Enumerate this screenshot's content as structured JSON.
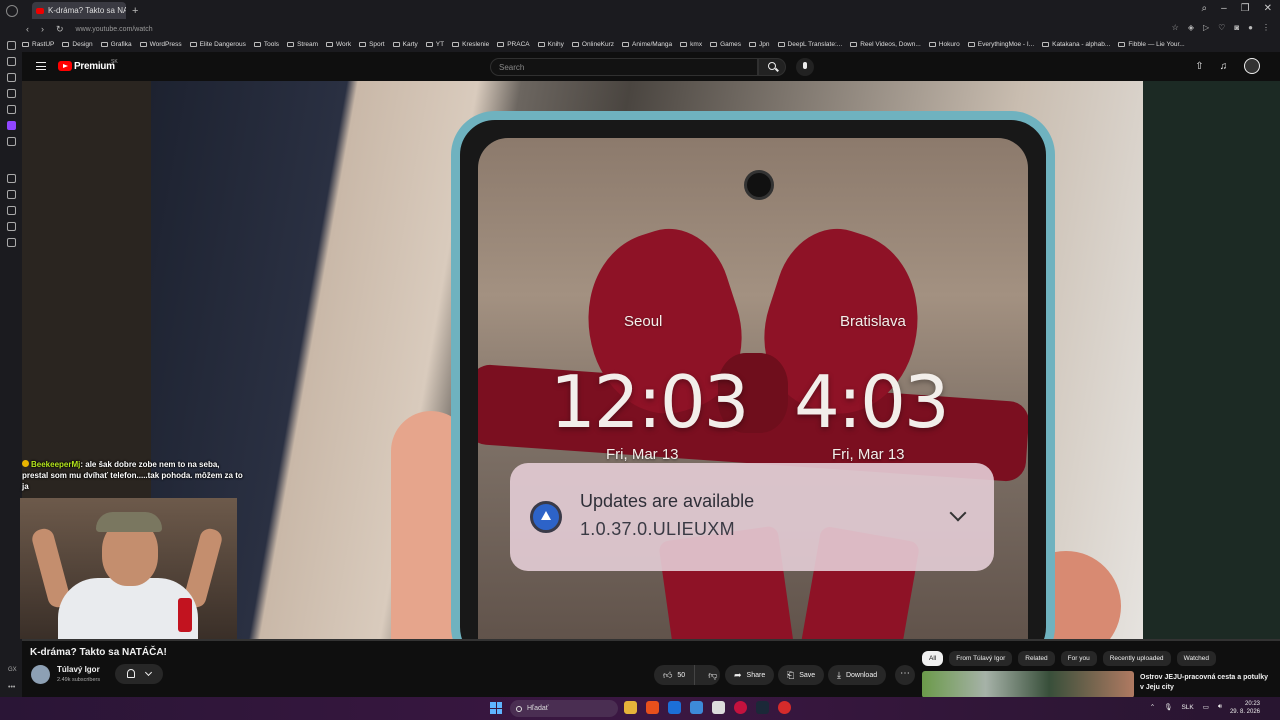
{
  "browser": {
    "tab_title": "K-dráma? Takto sa NA...",
    "url": "www.youtube.com/watch",
    "bookmarks": [
      "RastUP",
      "Design",
      "Grafika",
      "WordPress",
      "Elite Dangerous",
      "Tools",
      "Stream",
      "Work",
      "Sport",
      "Karty",
      "YT",
      "Kreslenie",
      "PRACA",
      "Knihy",
      "OnlineKurz",
      "Anime/Manga",
      "kmx",
      "Games",
      "Jpn",
      "DeepL Translate:...",
      "Reel Videos, Down...",
      "Hokuro",
      "EverythingMoe - I...",
      "Katakana - alphab...",
      "Fibble — Lie Your..."
    ]
  },
  "youtube": {
    "brand": "Premium",
    "country": "SK",
    "search_placeholder": "Search"
  },
  "video": {
    "screen": {
      "city_left": "Seoul",
      "city_right": "Bratislava",
      "time_left": "12:03",
      "time_right": "4:03",
      "date_left": "Fri, Mar 13",
      "date_right": "Fri, Mar 13",
      "notif_title": "Updates are available",
      "notif_version": "1.0.37.0.ULIEUXM"
    },
    "title": "K-dráma? Takto sa NATÁČA!",
    "channel": "Túlavý Igor",
    "subscribers": "2.49k subscribers",
    "likes": "50",
    "share_label": "Share",
    "save_label": "Save",
    "download_label": "Download"
  },
  "overlay": {
    "chat_user": "BeekeeperMj",
    "chat_text": ": ale šak dobre zobe nem to na seba, prestal som mu dvíhať telefon.....tak pohoda. môžem za to ja"
  },
  "chips": [
    "All",
    "From Túlavý Igor",
    "Related",
    "For you",
    "Recently uploaded",
    "Watched"
  ],
  "recommended": {
    "title": "Ostrov JEJU-pracovná cesta a potulky v Jeju city"
  },
  "taskbar": {
    "search_label": "Hľadať",
    "lang": "SLK",
    "time": "20:23",
    "date": "29. 8. 2026"
  },
  "colors": {
    "yt_red": "#ff0000",
    "chat_user_green": "#b5e61d",
    "phone_frame": "#6fb2bf",
    "bow_red": "#8e1226"
  }
}
